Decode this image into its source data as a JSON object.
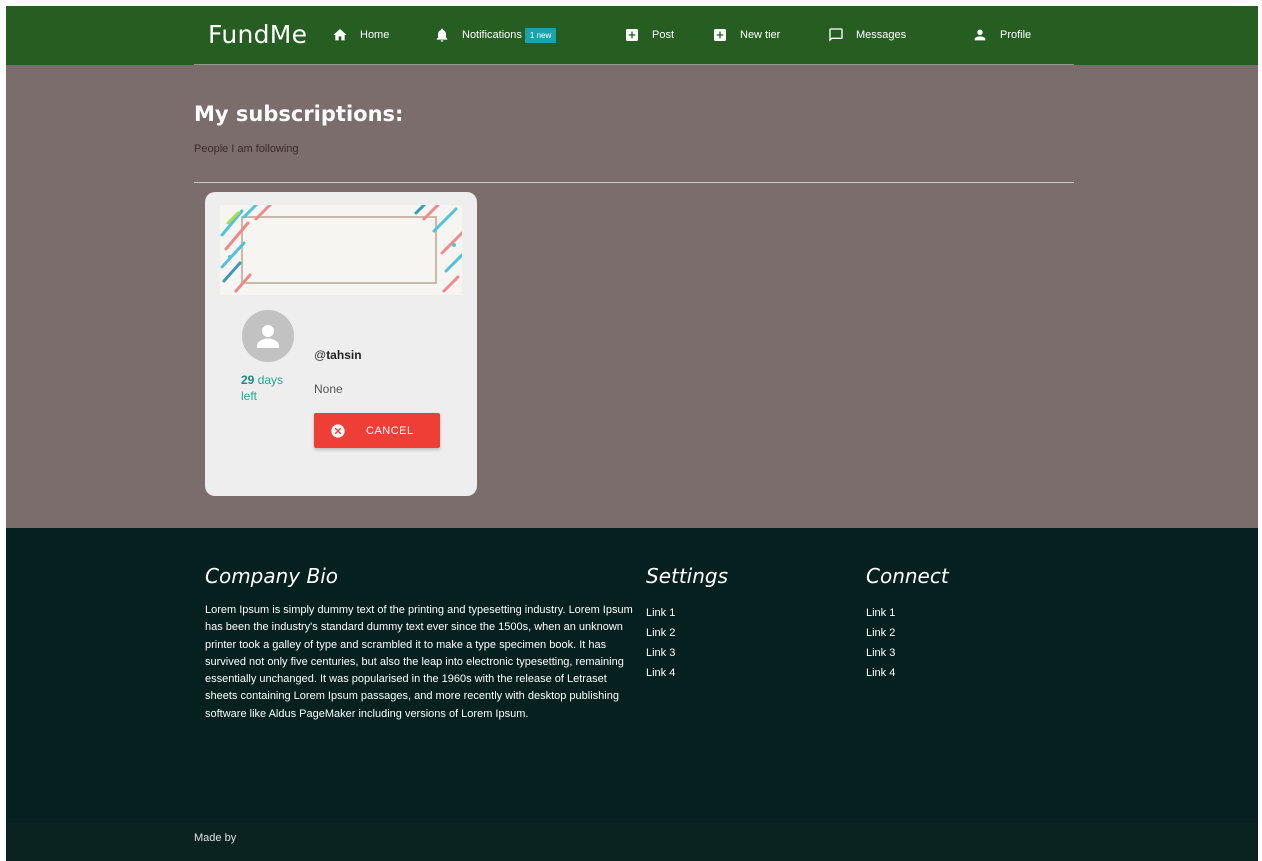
{
  "navbar": {
    "brand": "FundMe",
    "items": [
      {
        "label": "Home",
        "icon": "home-icon"
      },
      {
        "label": "Notifications",
        "icon": "bell-icon",
        "badge": "1 new"
      },
      {
        "label": "Post",
        "icon": "add-box-icon"
      },
      {
        "label": "New tier",
        "icon": "add-box-icon"
      },
      {
        "label": "Messages",
        "icon": "message-icon"
      },
      {
        "label": "Profile",
        "icon": "person-icon"
      }
    ]
  },
  "main": {
    "title": "My subscriptions:",
    "subtitle": "People I am following"
  },
  "subscription_card": {
    "days_number": "29",
    "days_suffix": "days left",
    "username": "tahsin",
    "at_sign": "@",
    "tier": "None",
    "cancel_label": "CANCEL"
  },
  "footer": {
    "bio": {
      "heading": "Company Bio",
      "text": "Lorem Ipsum is simply dummy text of the printing and typesetting industry. Lorem Ipsum has been the industry's standard dummy text ever since the 1500s, when an unknown printer took a galley of type and scrambled it to make a type specimen book. It has survived not only five centuries, but also the leap into electronic typesetting, remaining essentially unchanged. It was popularised in the 1960s with the release of Letraset sheets containing Lorem Ipsum passages, and more recently with desktop publishing software like Aldus PageMaker including versions of Lorem Ipsum."
    },
    "settings": {
      "heading": "Settings",
      "links": [
        "Link 1",
        "Link 2",
        "Link 3",
        "Link 4"
      ]
    },
    "connect": {
      "heading": "Connect",
      "links": [
        "Link 1",
        "Link 2",
        "Link 3",
        "Link 4"
      ]
    },
    "made_by": "Made by"
  },
  "colors": {
    "navbar": "#265e22",
    "main_bg": "#7a6d6b",
    "footer_bg": "#04201f",
    "cancel": "#ef3e36",
    "badge": "#1aa4ad",
    "accent_teal": "#26a69a"
  }
}
